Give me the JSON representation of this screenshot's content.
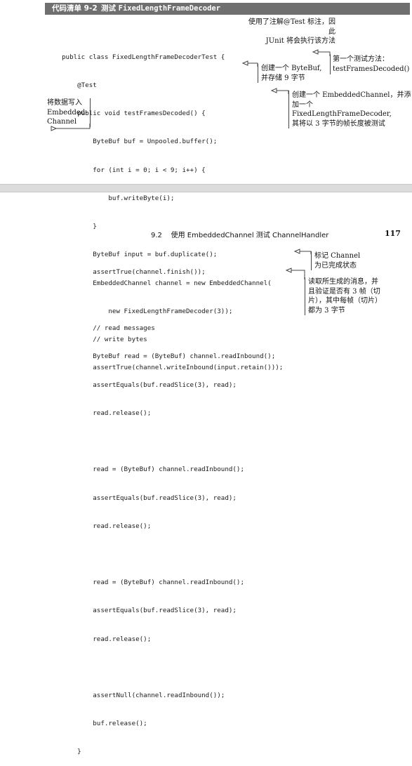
{
  "header": {
    "listing_label": "代码清单 9-2",
    "title_prefix": "测试",
    "title_code": "FixedLengthFrameDecoder"
  },
  "page_top": {
    "code_lines": [
      "public class FixedLengthFrameDecoderTest {",
      "    @Test",
      "    public void testFramesDecoded() {",
      "        ByteBuf buf = Unpooled.buffer();",
      "        for (int i = 0; i < 9; i++) {",
      "            buf.writeByte(i);",
      "        }",
      "        ByteBuf input = buf.duplicate();",
      "        EmbeddedChannel channel = new EmbeddedChannel(",
      "            new FixedLengthFrameDecoder(3));",
      "        // write bytes",
      "        assertTrue(channel.writeInbound(input.retain()));"
    ],
    "annotations": {
      "test_annotation": [
        "使用了注解@Test 标注，因此",
        "JUnit 将会执行该方法"
      ],
      "first_test_method": [
        "第一个测试方法：",
        "testFramesDecoded()"
      ],
      "create_bytebuf": [
        "创建一个 ByteBuf,",
        "并存储 9 字节"
      ],
      "create_channel": [
        "创建一个 EmbeddedChannel，并添",
        "加一个 FixedLengthFrameDecoder,",
        "其将以 3 字节的帧长度被测试"
      ],
      "write_data": [
        "将数据写入",
        "Embedded-",
        "Channel"
      ]
    }
  },
  "page_bottom": {
    "running_head": "9.2    使用 EmbeddedChannel 测试 ChannelHandler",
    "page_number": "117",
    "code_lines": [
      "        assertTrue(channel.finish());",
      "",
      "        // read messages",
      "        ByteBuf read = (ByteBuf) channel.readInbound();",
      "        assertEquals(buf.readSlice(3), read);",
      "        read.release();",
      "",
      "        read = (ByteBuf) channel.readInbound();",
      "        assertEquals(buf.readSlice(3), read);",
      "        read.release();",
      "",
      "        read = (ByteBuf) channel.readInbound();",
      "        assertEquals(buf.readSlice(3), read);",
      "        read.release();",
      "",
      "        assertNull(channel.readInbound());",
      "        buf.release();",
      "    }"
    ],
    "annotations": {
      "mark_finished": [
        "标记 Channel",
        "为已完成状态"
      ],
      "read_messages": [
        "读取所生成的消息，并",
        "且验证是否有 3 帧（切",
        "片），其中每帧（切片）",
        "都为 3 字节"
      ]
    }
  }
}
